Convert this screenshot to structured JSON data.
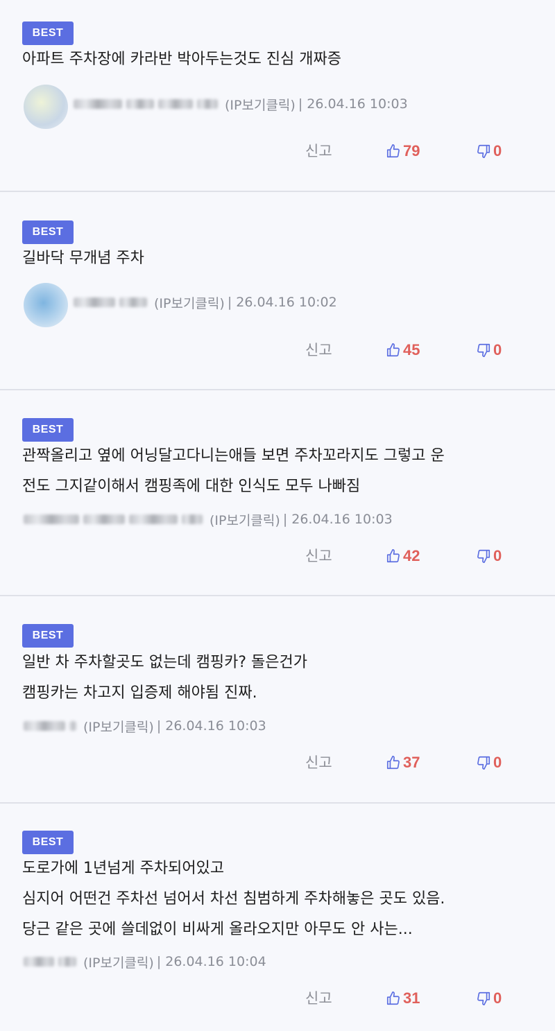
{
  "colors": {
    "badge": "#5b6ee1",
    "count": "#e0605b",
    "thumb": "#5b6ee1",
    "meta": "#8a8d96",
    "divider": "#dfe1e8"
  },
  "comments": [
    {
      "badge": "BEST",
      "lines": [
        "아파트 주차장에 카라반 박아두는것도 진심 개짜증"
      ],
      "ip_label": "(IP보기클릭)",
      "time": "| 26.04.16 10:03",
      "report": "신고",
      "likes": "79",
      "dislikes": "0"
    },
    {
      "badge": "BEST",
      "lines": [
        "길바닥 무개념 주차"
      ],
      "ip_label": "(IP보기클릭)",
      "time": "| 26.04.16 10:02",
      "report": "신고",
      "likes": "45",
      "dislikes": "0"
    },
    {
      "badge": "BEST",
      "lines": [
        "관짝올리고 옆에 어닝달고다니는애들 보면 주차꼬라지도 그렇고 운",
        "전도 그지같이해서 캠핑족에 대한 인식도 모두 나빠짐"
      ],
      "ip_label": "(IP보기클릭)",
      "time": "| 26.04.16 10:03",
      "report": "신고",
      "likes": "42",
      "dislikes": "0"
    },
    {
      "badge": "BEST",
      "lines": [
        "일반 차 주차할곳도 없는데 캠핑카? 돌은건가",
        "캠핑카는 차고지 입증제 해야됨 진짜."
      ],
      "ip_label": "(IP보기클릭)",
      "time": "| 26.04.16 10:03",
      "report": "신고",
      "likes": "37",
      "dislikes": "0"
    },
    {
      "badge": "BEST",
      "lines": [
        "도로가에 1년넘게 주차되어있고",
        "심지어 어떤건 주차선 넘어서 차선 침범하게 주차해놓은 곳도 있음.",
        "당근 같은 곳에 쓸데없이 비싸게 올라오지만 아무도 안 사는..."
      ],
      "ip_label": "(IP보기클릭)",
      "time": "| 26.04.16 10:04",
      "report": "신고",
      "likes": "31",
      "dislikes": "0"
    }
  ]
}
